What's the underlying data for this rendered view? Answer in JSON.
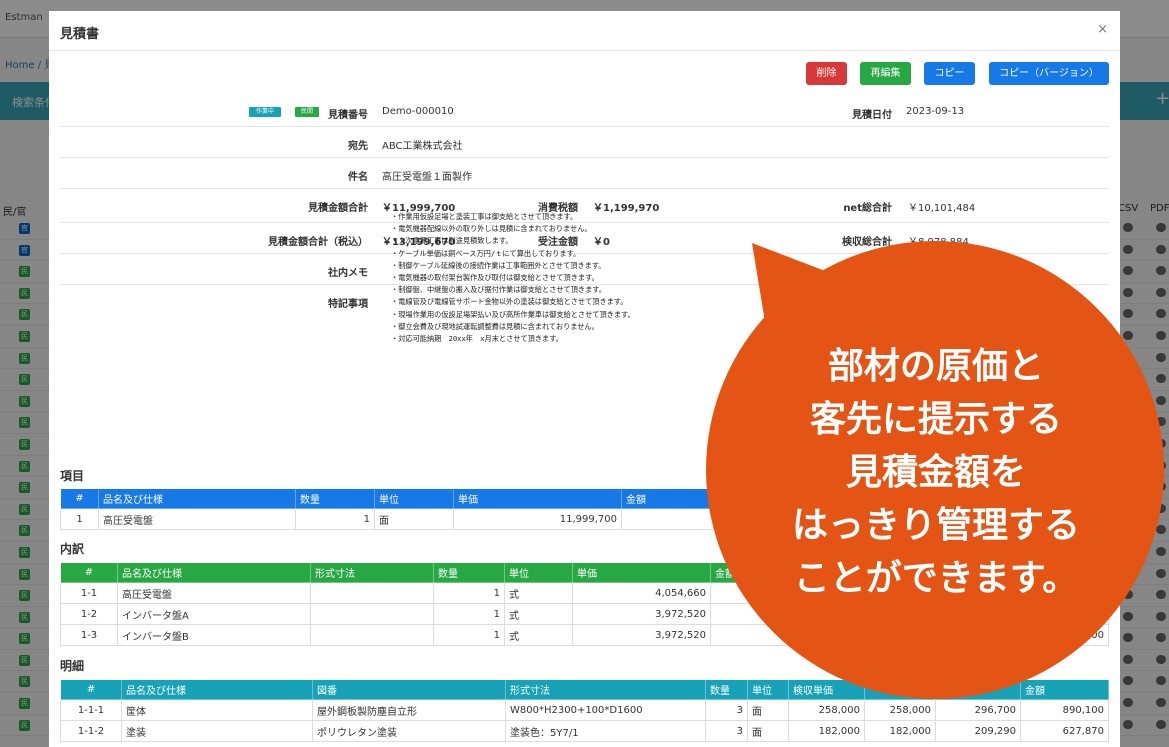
{
  "background": {
    "brand": "Estman",
    "breadcrumb": "Home / 見",
    "search_bar": "検索条件",
    "col_left": "民/官",
    "col_csv": "CSV",
    "col_pdf": "PDF",
    "badge_gov": "官",
    "badge_private": "民"
  },
  "modal": {
    "title": "見積書",
    "close": "×",
    "buttons": {
      "delete": "削除",
      "reedit": "再編集",
      "copy": "コピー",
      "copy_version": "コピー（バージョン）"
    },
    "tags": {
      "status": "作業中",
      "sector": "民間"
    },
    "labels": {
      "number": "見積番号",
      "date": "見積日付",
      "addressee": "宛先",
      "subject": "件名",
      "total": "見積金額合計",
      "tax": "消費税額",
      "net": "net総合計",
      "total_tax": "見積金額合計（税込）",
      "order": "受注金額",
      "acceptance": "検収総合計",
      "memo": "社内メモ",
      "notes": "特記事項"
    },
    "values": {
      "number": "Demo-000010",
      "date": "2023-09-13",
      "addressee": "ABC工業株式会社",
      "subject": "高圧受電盤１面製作",
      "total": "￥11,999,700",
      "tax": "￥1,199,970",
      "net": "￥10,101,484",
      "total_tax": "￥13,199,670",
      "order": "￥0",
      "acceptance": "￥8,978,884",
      "memo": ""
    },
    "notes": [
      "・作業用仮設足場と塗装工事は御支給とさせて頂きます。",
      "・電気機器配線以外の取り外しは見積に含まれておりません。",
      "・１次電源工事は別途見積致します。",
      "・ケーブル単価は銅ベース万円/ｔにて算出しております。",
      "・制御ケーブル延線後の接続作業は工事範囲外とさせて頂きます。",
      "・電気機器の取付架台製作及び取付は御支給とさせて頂きます。",
      "・制御盤、中継盤の搬入及び据付作業は御支給とさせて頂きます。",
      "・電線管及び電線管サポート金物以外の塗装は御支給とさせて頂きます。",
      "・現場作業用の仮設足場架払い及び高所作業車は御支給とさせて頂きます。",
      "・御立会費及び現地試運転調整費は見積に含まれておりません。",
      "・対応可能納期　20xx年　x月末とさせて頂きます。"
    ]
  },
  "items_section": {
    "title": "項目",
    "headers": [
      "#",
      "品名及び仕様",
      "数量",
      "単位",
      "単価",
      "金額"
    ],
    "rows": [
      [
        "1",
        "高圧受電盤",
        "1",
        "面",
        "11,999,700",
        ""
      ]
    ]
  },
  "breakdown_section": {
    "title": "内訳",
    "headers": [
      "#",
      "品名及び仕様",
      "形式寸法",
      "数量",
      "単位",
      "単価",
      "金額"
    ],
    "rows": [
      [
        "1-1",
        "高圧受電盤",
        "",
        "1",
        "式",
        "4,054,660",
        ""
      ],
      [
        "1-2",
        "インバータ盤A",
        "",
        "1",
        "式",
        "3,972,520",
        ""
      ],
      [
        "1-3",
        "インバータ盤B",
        "",
        "1",
        "式",
        "3,972,520",
        "300"
      ]
    ]
  },
  "detail_section": {
    "title": "明細",
    "headers": [
      "#",
      "品名及び仕様",
      "図番",
      "形式寸法",
      "数量",
      "単位",
      "検収単価",
      "",
      "",
      "金額"
    ],
    "rows": [
      [
        "1-1-1",
        "筐体",
        "屋外鋼板製防塵自立形",
        "W800*H2300+100*D1600",
        "3",
        "面",
        "258,000",
        "258,000",
        "296,700",
        "890,100"
      ],
      [
        "1-1-2",
        "塗装",
        "ポリウレタン塗装",
        "塗装色：5Y7/1",
        "3",
        "面",
        "182,000",
        "182,000",
        "209,290",
        "627,870"
      ]
    ]
  },
  "callout": {
    "lines": [
      "部材の原価と",
      "客先に提示する",
      "見積金額を",
      "はっきり管理する",
      "ことができます。"
    ],
    "color": "#e45414"
  }
}
